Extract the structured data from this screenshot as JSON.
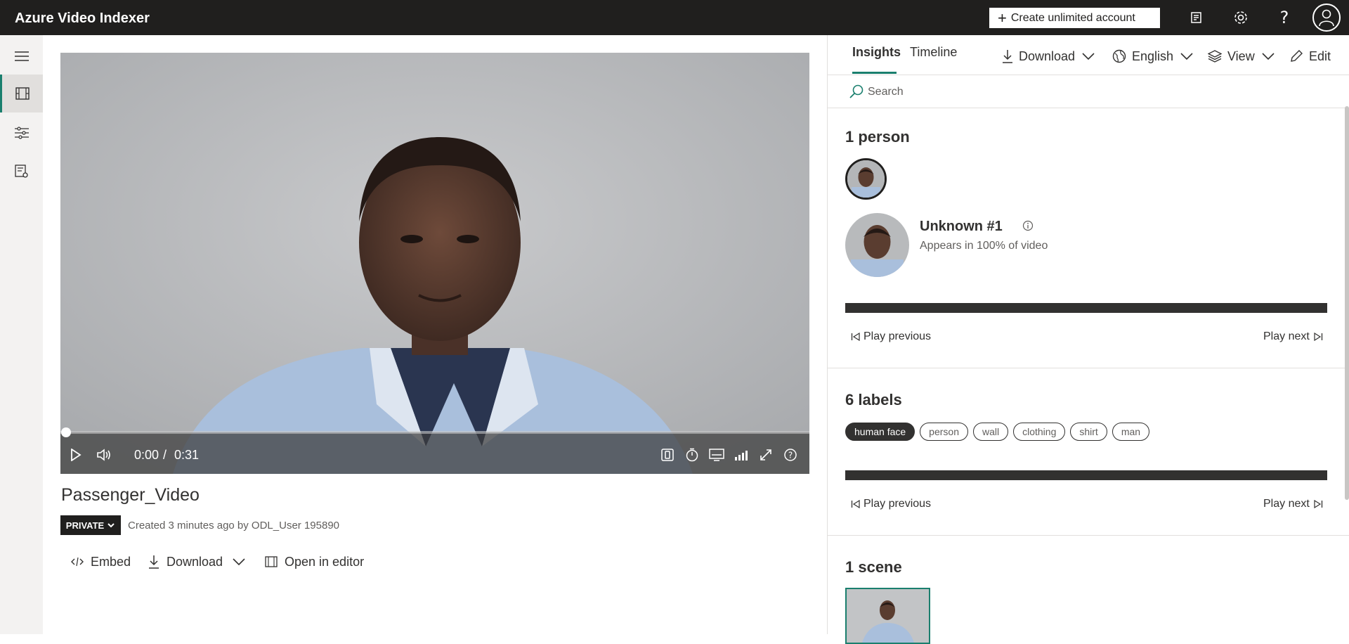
{
  "app": {
    "title": "Azure Video Indexer"
  },
  "topbar": {
    "create_label": "Create unlimited account",
    "icons": [
      "notes-icon",
      "gear-icon",
      "help-icon",
      "user-avatar-icon"
    ]
  },
  "rail": {
    "items": [
      "menu-icon",
      "video-library-icon",
      "model-customization-icon",
      "settings-list-icon"
    ]
  },
  "player": {
    "current_time": "0:00",
    "separator": "/",
    "duration": "0:31",
    "progress": 0.0
  },
  "video": {
    "title": "Passenger_Video",
    "privacy_label": "PRIVATE",
    "created_text": "Created 3 minutes ago by ODL_User 195890",
    "actions": {
      "embed": "Embed",
      "download": "Download",
      "editor": "Open in editor"
    }
  },
  "panel": {
    "tabs": {
      "insights": "Insights",
      "timeline": "Timeline"
    },
    "toolbar": {
      "download": "Download",
      "language": "English",
      "view": "View",
      "edit": "Edit"
    },
    "search": {
      "placeholder": "Search"
    },
    "people": {
      "title": "1 person",
      "name": "Unknown #1",
      "appears": "Appears in 100% of video",
      "play_previous": "Play previous",
      "play_next": "Play next"
    },
    "labels": {
      "title": "6 labels",
      "items": [
        "human face",
        "person",
        "wall",
        "clothing",
        "shirt",
        "man"
      ],
      "play_previous": "Play previous",
      "play_next": "Play next"
    },
    "scenes": {
      "title": "1 scene"
    }
  },
  "colors": {
    "accent": "#1a7f6e",
    "topbar": "#201f1e",
    "rail": "#f3f2f1"
  }
}
